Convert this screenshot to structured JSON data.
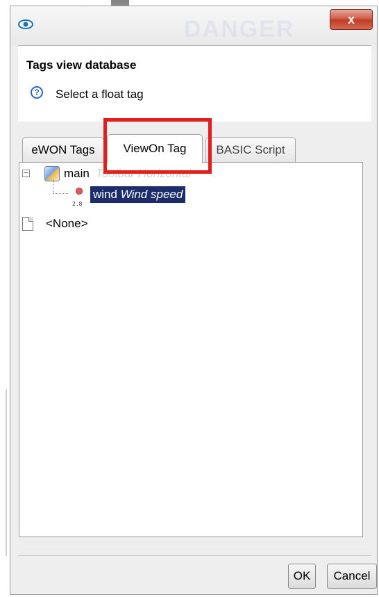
{
  "window": {
    "close_label": "x",
    "watermark": "DANGER"
  },
  "header": {
    "title": "Tags view database",
    "help_glyph": "?",
    "message": "Select a float tag"
  },
  "tabs": [
    {
      "label": "eWON Tags",
      "active": false
    },
    {
      "label": "ViewOn Tag",
      "active": true
    },
    {
      "label": "BASIC Script",
      "active": false
    }
  ],
  "tree": {
    "main": {
      "label": "main",
      "description": "Toolbar Horizontal",
      "expander": "−",
      "icon": "page-image-icon"
    },
    "wind": {
      "name": "wind",
      "description": "Wind speed",
      "value": "2.8",
      "icon": "tag-status-icon"
    },
    "none": {
      "label": "<None>",
      "icon": "document-icon"
    }
  },
  "buttons": {
    "ok": "OK",
    "cancel": "Cancel"
  },
  "colors": {
    "selection": "#1b2e6b",
    "highlight": "#e02020",
    "accent": "#2a67c3"
  }
}
